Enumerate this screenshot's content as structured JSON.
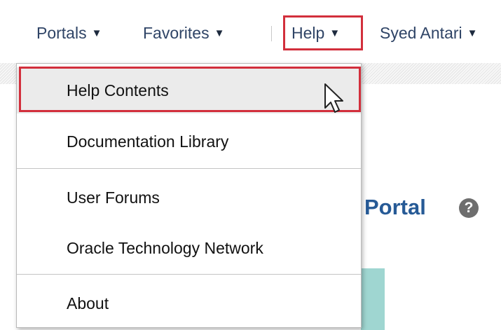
{
  "header": {
    "nav": [
      {
        "label": "Portals",
        "icon": "caret-down-icon"
      },
      {
        "label": "Favorites",
        "icon": "caret-down-icon"
      },
      {
        "label": "Help",
        "icon": "caret-down-icon"
      },
      {
        "label": "Syed Antari",
        "icon": "caret-down-icon"
      }
    ],
    "caret_glyph": "▼"
  },
  "help_menu": {
    "items": [
      {
        "label": "Help Contents",
        "state": "hovered"
      },
      {
        "label": "Documentation Library"
      },
      {
        "label": "User Forums"
      },
      {
        "label": "Oracle Technology Network"
      },
      {
        "label": "About"
      }
    ]
  },
  "page": {
    "title_fragment": "Portal",
    "help_icon_glyph": "?"
  },
  "colors": {
    "highlight_border": "#d22f3c",
    "nav_text": "#2f4466",
    "title_blue": "#265a96",
    "panel_teal": "#9fd6d1",
    "hover_bg": "#ebebeb"
  },
  "icons": {
    "cursor": "arrow-cursor-icon",
    "page_help": "question-circle-icon"
  }
}
